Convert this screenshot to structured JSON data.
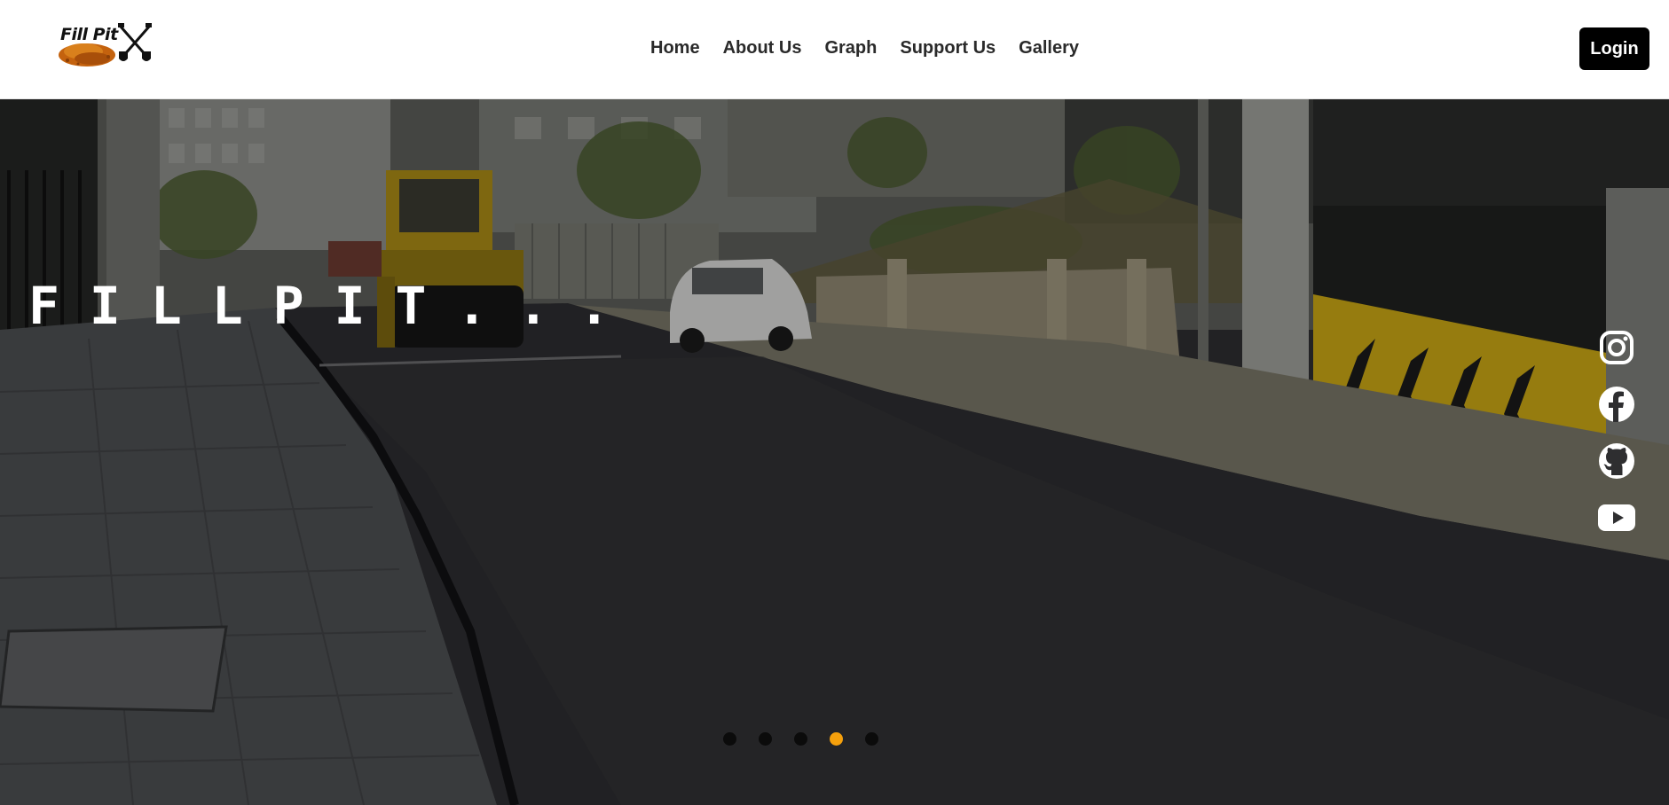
{
  "brand": {
    "logo_text": "Fill Pit"
  },
  "nav": {
    "links": [
      "Home",
      "About Us",
      "Graph",
      "Support Us",
      "Gallery"
    ],
    "login_label": "Login"
  },
  "hero": {
    "title": "FILLPIT...",
    "slides_total": 5,
    "active_slide": 4,
    "colors": {
      "active_dot": "#f5a00c",
      "inactive_dot": "#0b0b0b",
      "title": "#ffffff"
    }
  },
  "social": {
    "icons": [
      "instagram-icon",
      "facebook-icon",
      "github-icon",
      "youtube-icon"
    ]
  }
}
